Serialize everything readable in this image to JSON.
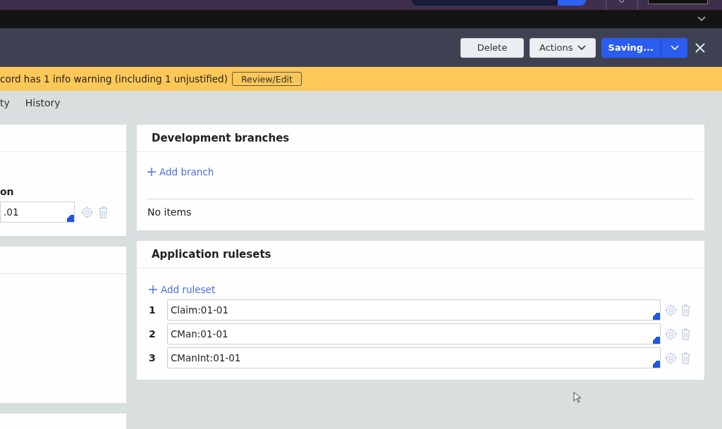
{
  "header": {
    "buttons": [
      {
        "kind": "plain",
        "label": "Delete"
      },
      {
        "kind": "menu",
        "label": "Actions"
      },
      {
        "kind": "primary",
        "label": "Saving..."
      }
    ]
  },
  "banner": {
    "message": "cord has 1 info warning (including 1 unjustified)",
    "button": "Review/Edit"
  },
  "tabs": [
    {
      "label": "ty",
      "selected": false
    },
    {
      "label": "History",
      "selected": false
    }
  ],
  "left_panel": {
    "field_label": "on",
    "field_value": ".01"
  },
  "development_branches": {
    "title": "Development branches",
    "add_link": "Add branch",
    "empty_text": "No items"
  },
  "application_rulesets": {
    "title": "Application rulesets",
    "add_link": "Add ruleset",
    "rows": [
      {
        "index": "1",
        "value": "Claim:01-01"
      },
      {
        "index": "2",
        "value": "CMan:01-01"
      },
      {
        "index": "3",
        "value": "CManInt:01-01"
      }
    ]
  }
}
